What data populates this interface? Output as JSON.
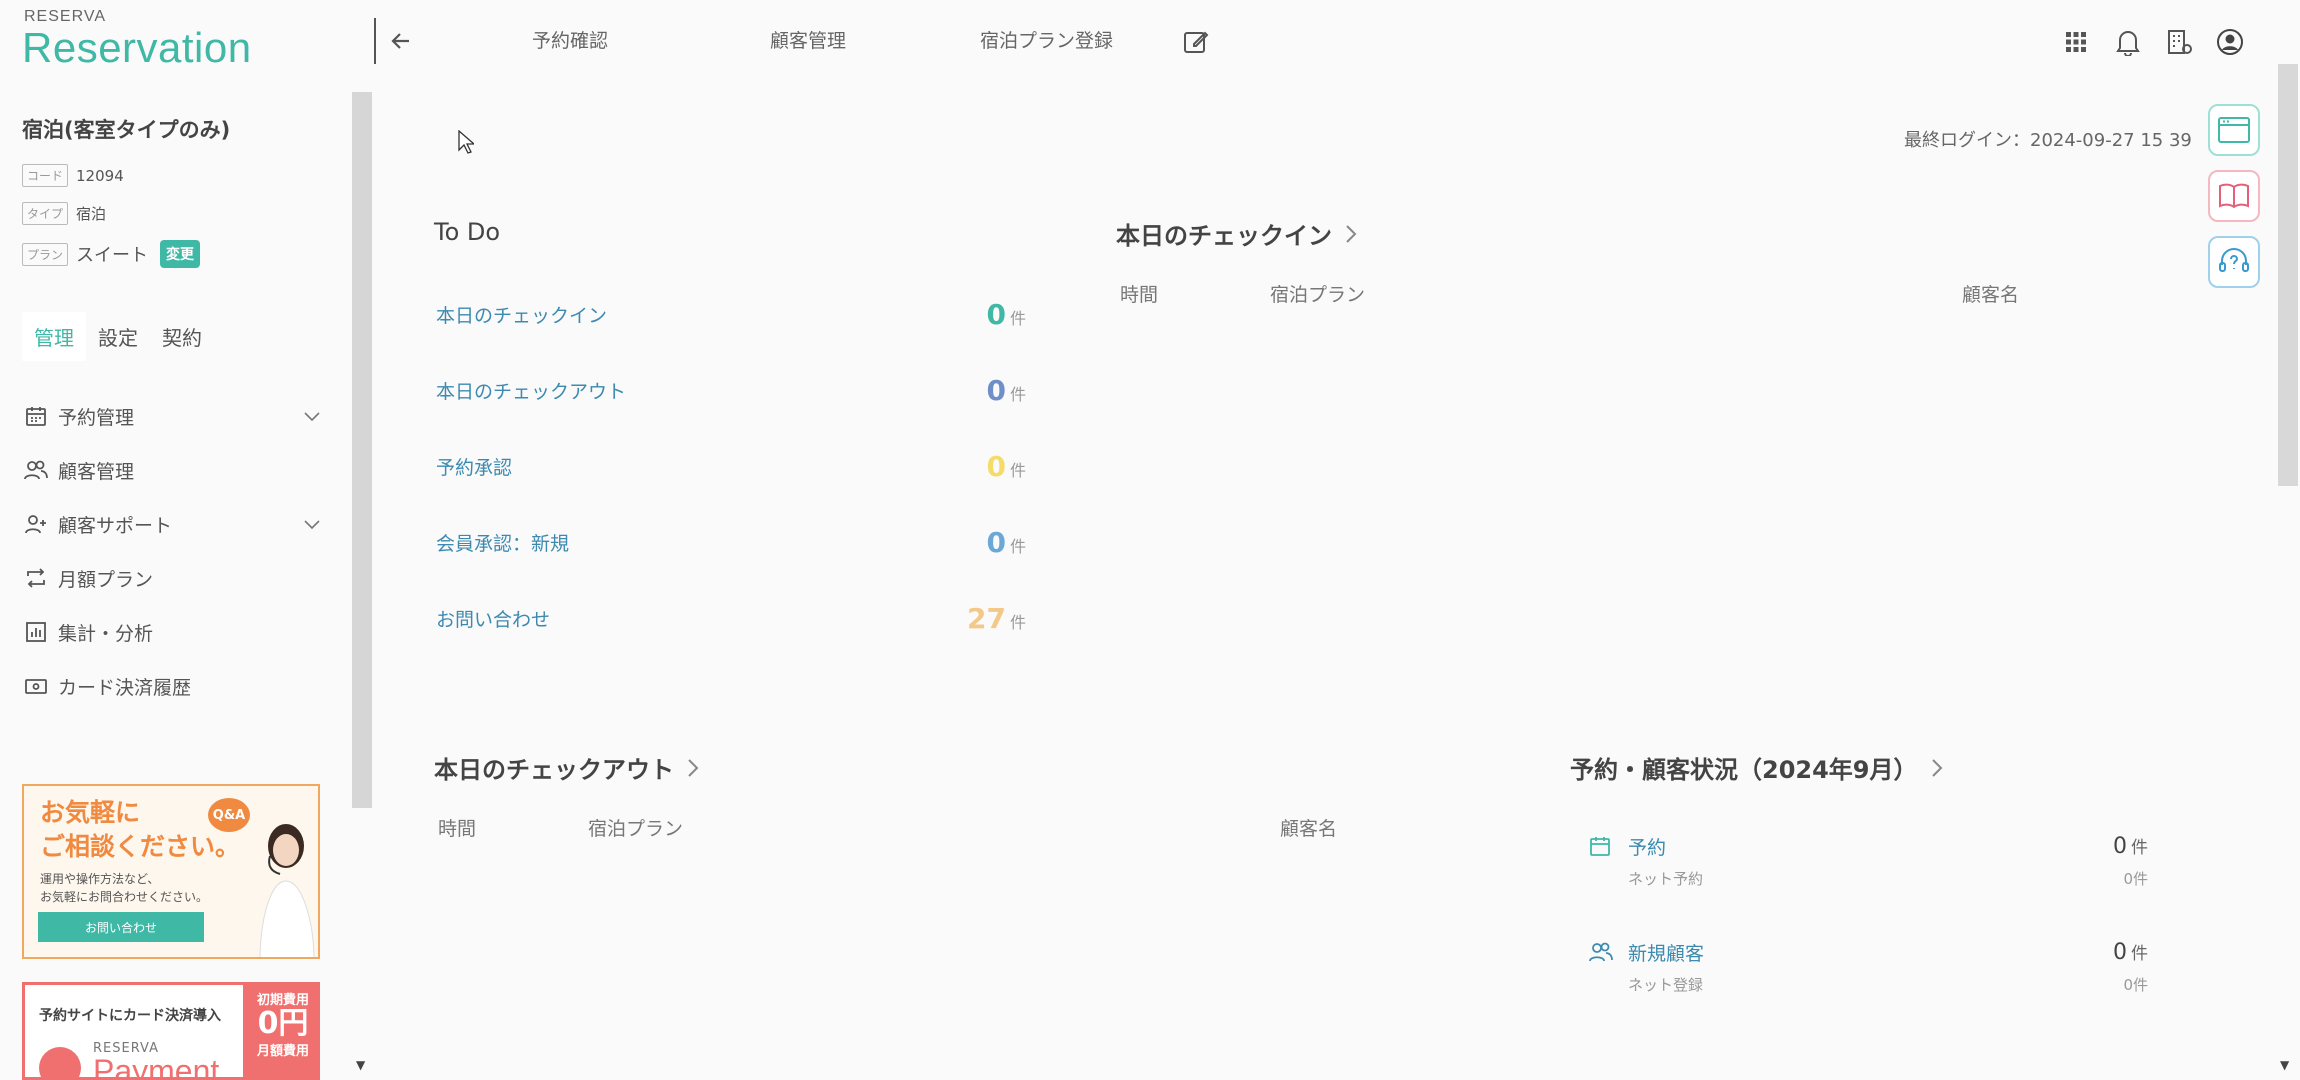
{
  "header": {
    "logo_small": "RESERVA",
    "logo_big": "Reservation",
    "nav": [
      "予約確認",
      "顧客管理",
      "宿泊プラン登録"
    ],
    "icons": [
      "grid-icon",
      "bell-icon",
      "building-settings-icon",
      "user-icon"
    ]
  },
  "sidebar": {
    "plan_title": "宿泊(客室タイプのみ)",
    "code_tag": "コード",
    "code_value": "12094",
    "type_tag": "タイプ",
    "type_value": "宿泊",
    "plan_tag": "プラン",
    "plan_value": "スイート",
    "change_label": "変更",
    "tabs": [
      "管理",
      "設定",
      "契約"
    ],
    "active_tab": "管理",
    "items": [
      {
        "label": "予約管理",
        "icon": "calendar-icon",
        "expandable": true
      },
      {
        "label": "顧客管理",
        "icon": "users-icon",
        "expandable": false
      },
      {
        "label": "顧客サポート",
        "icon": "user-plus-icon",
        "expandable": true
      },
      {
        "label": "月額プラン",
        "icon": "repeat-icon",
        "expandable": false
      },
      {
        "label": "集計・分析",
        "icon": "bar-chart-icon",
        "expandable": false
      },
      {
        "label": "カード決済履歴",
        "icon": "payment-card-icon",
        "expandable": false
      }
    ]
  },
  "banner1": {
    "headline_1": "お気軽に",
    "headline_2": "ご相談ください。",
    "qa": "Q&A",
    "sub_1": "運用や操作方法など、",
    "sub_2": "お気軽にお問合わせください。",
    "button": "お問い合わせ"
  },
  "banner2": {
    "headline": "予約サイトにカード決済導入",
    "brand_small": "RESERVA",
    "brand_big": "Payment",
    "right_1": "初期費用",
    "right_2": "0円",
    "right_3": "月額費用"
  },
  "main": {
    "last_login": "最終ログイン：2024-09-27 15 39",
    "todo": {
      "title": "To Do",
      "items": [
        {
          "label": "本日のチェックイン",
          "value": "0",
          "unit": "件",
          "color": "#3fb8a6"
        },
        {
          "label": "本日のチェックアウト",
          "value": "0",
          "unit": "件",
          "color": "#6f8fc8"
        },
        {
          "label": "予約承認",
          "value": "0",
          "unit": "件",
          "color": "#f5dc6a"
        },
        {
          "label": "会員承認：新規",
          "value": "0",
          "unit": "件",
          "color": "#6aa8d8"
        },
        {
          "label": "お問い合わせ",
          "value": "27",
          "unit": "件",
          "color": "#f3c98a"
        }
      ]
    },
    "checkin": {
      "title": "本日のチェックイン",
      "columns": [
        "時間",
        "宿泊プラン",
        "顧客名"
      ]
    },
    "checkout": {
      "title": "本日のチェックアウト",
      "columns": [
        "時間",
        "宿泊プラン",
        "顧客名"
      ]
    },
    "status": {
      "title": "予約・顧客状況（2024年9月）",
      "rows": [
        {
          "label": "予約",
          "value": "0",
          "unit": "件",
          "sub_label": "ネット予約",
          "sub_value": "0件",
          "icon": "calendar-icon"
        },
        {
          "label": "新規顧客",
          "value": "0",
          "unit": "件",
          "sub_label": "ネット登録",
          "sub_value": "0件",
          "icon": "users-icon"
        }
      ]
    },
    "float_buttons": [
      "browser-window-icon",
      "book-icon",
      "support-headset-icon"
    ]
  },
  "colors": {
    "brand": "#3fb8a6",
    "link": "#3d8ab0"
  }
}
